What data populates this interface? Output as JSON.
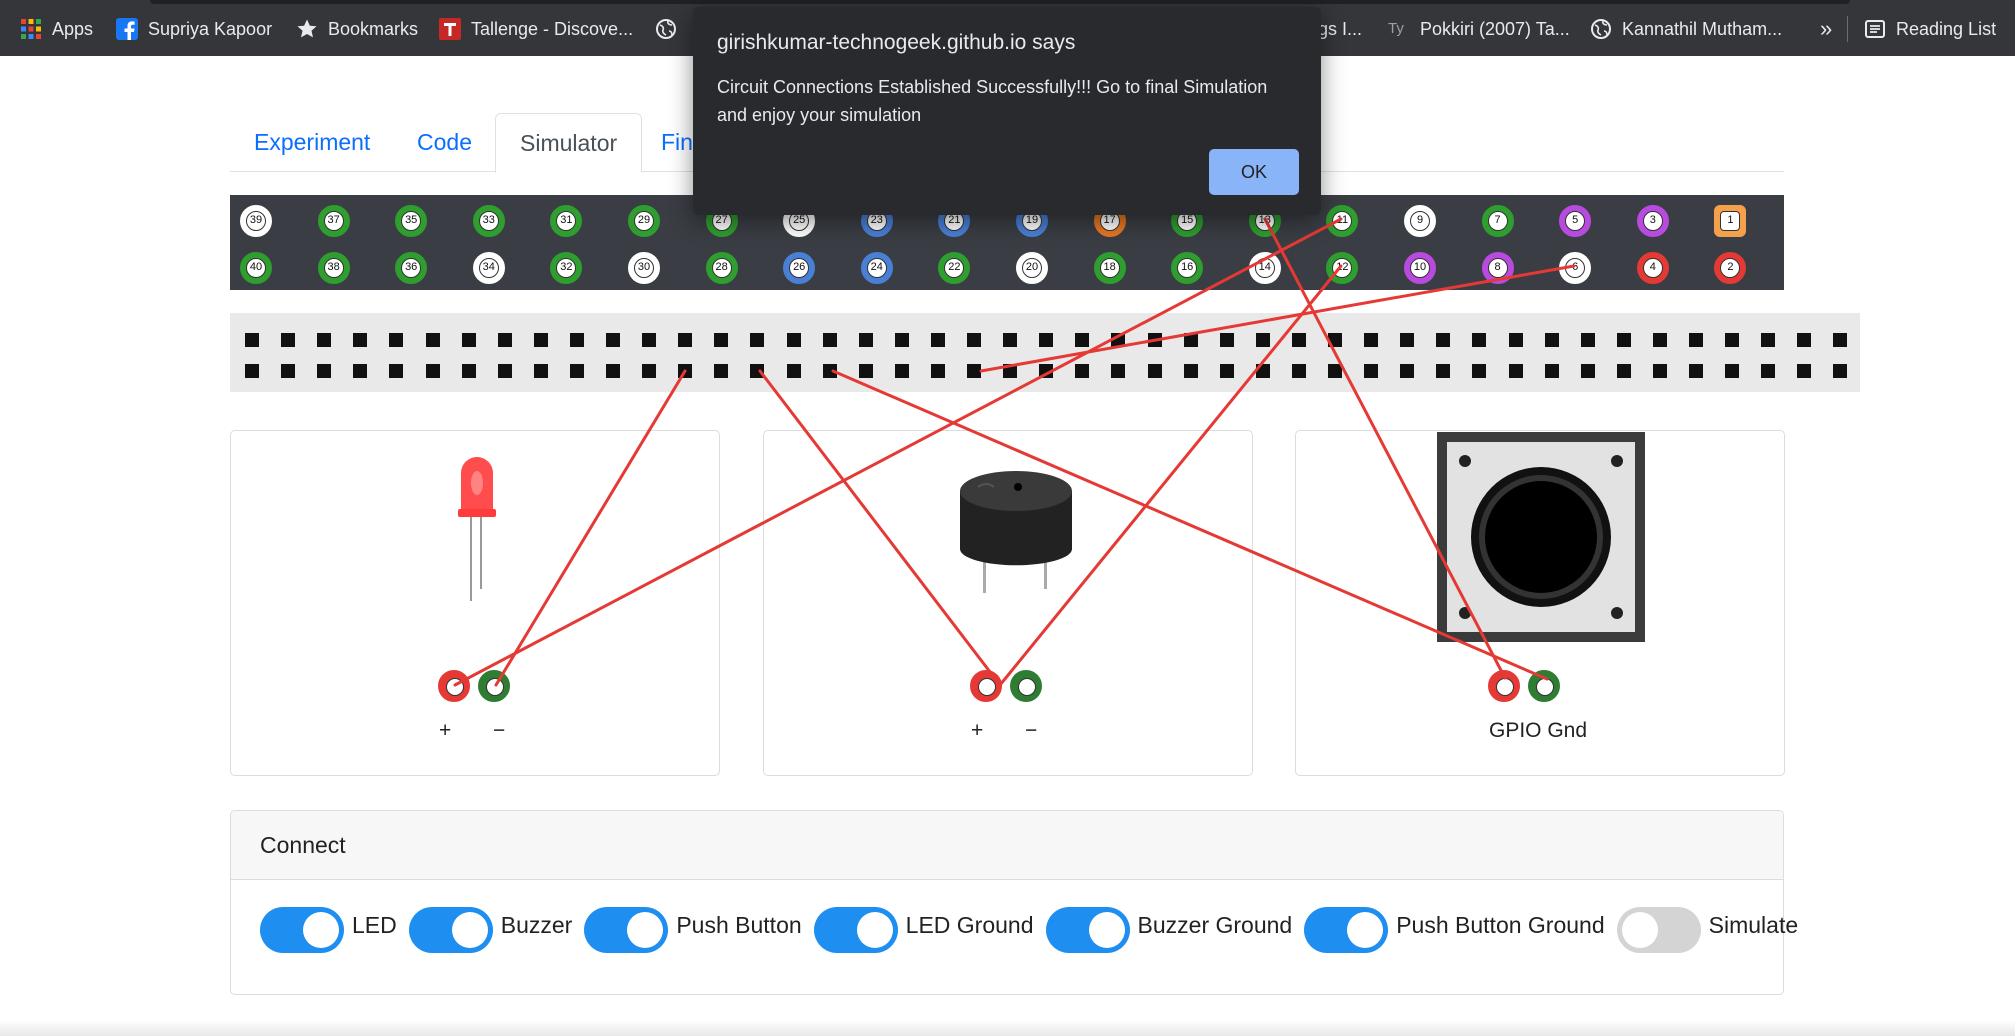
{
  "bookmarks": {
    "items": [
      {
        "label": "Apps",
        "icon": "apps-grid-icon"
      },
      {
        "label": "Supriya Kapoor",
        "icon": "facebook-icon"
      },
      {
        "label": "Bookmarks",
        "icon": "star-icon"
      },
      {
        "label": "Tallenge - Discove...",
        "icon": "tallenge-icon"
      },
      {
        "label": "",
        "icon": "globe-icon"
      },
      {
        "label": "gs I...",
        "icon": ""
      },
      {
        "label": "Pokkiri (2007) Ta...",
        "icon": "ty-icon"
      },
      {
        "label": "Kannathil Mutham...",
        "icon": "globe-icon"
      }
    ],
    "overflow": "»",
    "reading_list": "Reading List"
  },
  "tabs": [
    {
      "label": "Experiment",
      "active": false
    },
    {
      "label": "Code",
      "active": false
    },
    {
      "label": "Simulator",
      "active": true
    },
    {
      "label": "Fin",
      "active": false
    }
  ],
  "gpio": {
    "top_row": [
      "39",
      "37",
      "35",
      "33",
      "31",
      "29",
      "27",
      "25",
      "23",
      "21",
      "19",
      "17",
      "15",
      "13",
      "11",
      "9",
      "7",
      "5",
      "3",
      "1"
    ],
    "bottom_row": [
      "40",
      "38",
      "36",
      "34",
      "32",
      "30",
      "28",
      "26",
      "24",
      "22",
      "20",
      "18",
      "16",
      "14",
      "12",
      "10",
      "8",
      "6",
      "4",
      "2"
    ],
    "top_colors": [
      "#ffffff",
      "#2e9e2e",
      "#2e9e2e",
      "#2e9e2e",
      "#2e9e2e",
      "#2e9e2e",
      "#2e9e2e",
      "#ffffff",
      "#4a7fd6",
      "#4a7fd6",
      "#4a7fd6",
      "#e87722",
      "#2e9e2e",
      "#2e9e2e",
      "#2e9e2e",
      "#ffffff",
      "#2e9e2e",
      "#b84ae0",
      "#b84ae0",
      "#f5a04a"
    ],
    "bottom_colors": [
      "#2e9e2e",
      "#2e9e2e",
      "#2e9e2e",
      "#ffffff",
      "#2e9e2e",
      "#ffffff",
      "#2e9e2e",
      "#4a7fd6",
      "#4a7fd6",
      "#2e9e2e",
      "#ffffff",
      "#2e9e2e",
      "#2e9e2e",
      "#ffffff",
      "#2e9e2e",
      "#b84ae0",
      "#b84ae0",
      "#ffffff",
      "#e53935",
      "#e53935"
    ]
  },
  "components": {
    "led": {
      "plus": "+",
      "minus": "−"
    },
    "buzzer": {
      "plus": "+",
      "minus": "−"
    },
    "button": {
      "label": "GPIO Gnd"
    }
  },
  "connect": {
    "title": "Connect",
    "toggles": [
      {
        "label": "LED",
        "on": true
      },
      {
        "label": "Buzzer",
        "on": true
      },
      {
        "label": "Push Button",
        "on": true
      },
      {
        "label": "LED Ground",
        "on": true
      },
      {
        "label": "Buzzer Ground",
        "on": true
      },
      {
        "label": "Push Button Ground",
        "on": true
      },
      {
        "label": "Simulate",
        "on": false
      }
    ]
  },
  "dialog": {
    "title": "girishkumar-technogeek.github.io says",
    "message": "Circuit Connections Established Successfully!!! Go to final Simulation and enjoy your simulation",
    "ok_label": "OK"
  },
  "colors": {
    "wire": "#e53935",
    "accent": "#1f8ef1"
  }
}
